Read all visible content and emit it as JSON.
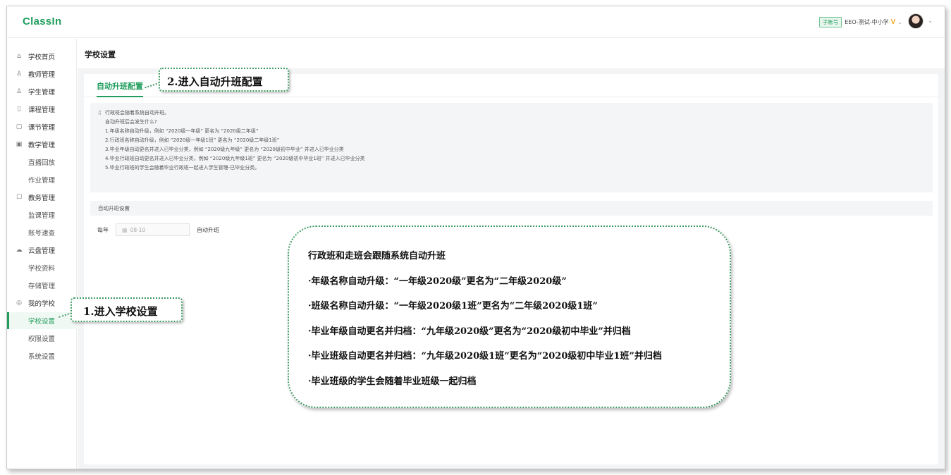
{
  "app": {
    "logo": "ClassIn"
  },
  "header": {
    "badge": "子账号",
    "account": "EEO-测试-中小学",
    "vip": "V",
    "chevron": "⌄"
  },
  "sidebar": {
    "items": [
      {
        "label": "学校首页",
        "icon": "home-icon"
      },
      {
        "label": "教师管理",
        "icon": "user-icon"
      },
      {
        "label": "学生管理",
        "icon": "users-icon"
      },
      {
        "label": "课程管理",
        "icon": "book-icon"
      },
      {
        "label": "课节管理",
        "icon": "calendar-icon"
      },
      {
        "label": "教学管理",
        "icon": "teach-icon"
      },
      {
        "label": "直播回放"
      },
      {
        "label": "作业管理"
      },
      {
        "label": "教务管理",
        "icon": "clipboard-icon"
      },
      {
        "label": "监课管理"
      },
      {
        "label": "账号速查"
      },
      {
        "label": "云盘管理",
        "icon": "cloud-icon"
      },
      {
        "label": "学校资料"
      },
      {
        "label": "存储管理"
      },
      {
        "label": "我的学校",
        "icon": "school-icon"
      },
      {
        "label": "学校设置",
        "active": true
      },
      {
        "label": "权限设置"
      },
      {
        "label": "系统设置"
      }
    ]
  },
  "page": {
    "title": "学校设置",
    "tab": "自动升班配置",
    "notice": [
      "行政班会随着系统自动升班。",
      "自动升班后会发生什么?",
      "1.年级名称自动升级，例如 “2020级一年级” 更名为 “2020级二年级”",
      "2.行政班名称自动升级，例如 “2020级一年级1班” 更名为 “2020级二年级1班”",
      "3.毕业年级自动更名并进入已毕业分类，例如 “2020级九年级” 更名为 “2020级初中毕业” 并进入已毕业分类",
      "4.毕业行政班自动更名并进入已毕业分类，例如 “2020级九年级1班” 更名为 “2020级初中毕业1班” 并进入已毕业分类",
      "5.毕业行政班的学生会随着毕业行政班一起进入学生管理-已毕业分类。"
    ],
    "section_title": "自动升班设置",
    "row_prefix": "每年",
    "date_value": "08-10",
    "row_suffix": "自动升班"
  },
  "annotations": {
    "step1": "1.进入学校设置",
    "step2": "2.进入自动升班配置",
    "bubble": [
      "行政班和走班会跟随系统自动升班",
      "·年级名称自动升级：“一年级2020级”更名为“二年级2020级”",
      "·班级名称自动升级：“一年级2020级1班”更名为“二年级2020级1班”",
      "·毕业年级自动更名并归档：“九年级2020级”更名为“2020级初中毕业”并归档",
      "·毕业班级自动更名并归档：“九年级2020级1班”更名为“2020级初中毕业1班”并归档",
      "·毕业班级的学生会随着毕业班级一起归档"
    ]
  },
  "colors": {
    "accent": "#1f9d5c",
    "vip": "#f2a81d",
    "callout_border": "#3e9a62"
  }
}
